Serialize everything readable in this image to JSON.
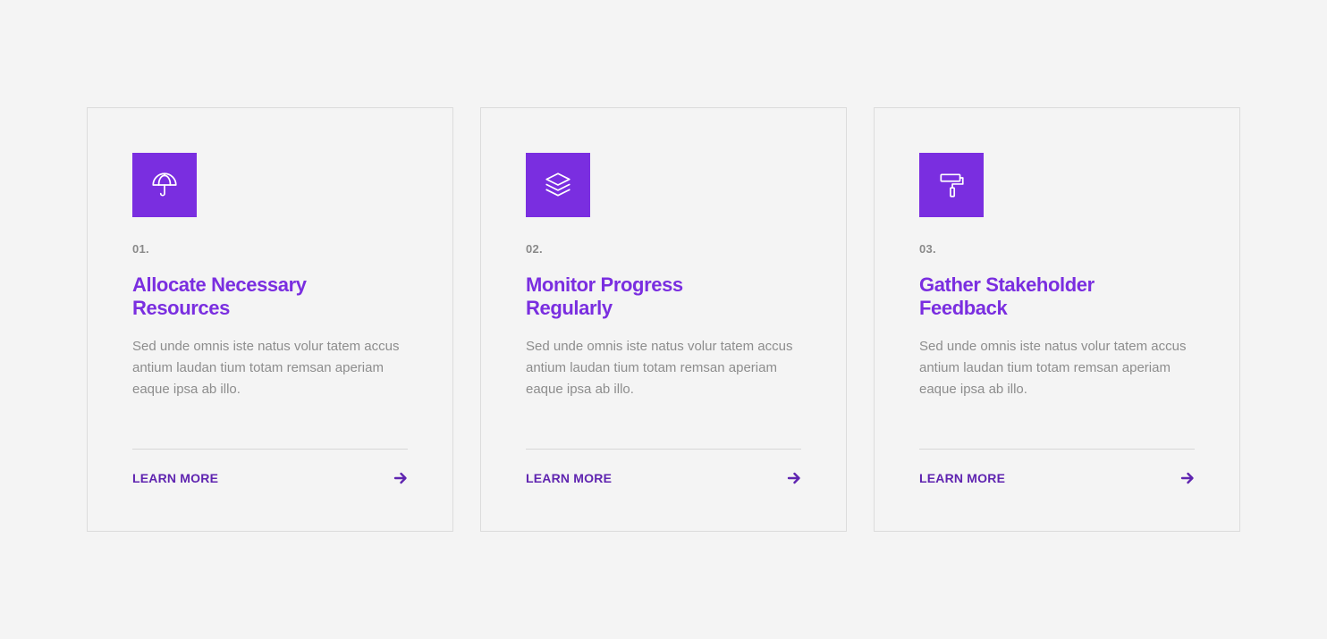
{
  "colors": {
    "accent": "#7a2ee0",
    "link": "#5f24b0",
    "background": "#f4f4f4",
    "muted_text": "#8d8d8d"
  },
  "cards": [
    {
      "icon": "umbrella-icon",
      "number": "01.",
      "title": "Allocate Necessary Resources",
      "description": "Sed unde omnis iste natus volur tatem accus antium laudan tium totam remsan aperiam eaque ipsa ab illo.",
      "link_label": "LEARN MORE",
      "arrow_icon": "arrow-right-icon"
    },
    {
      "icon": "layers-icon",
      "number": "02.",
      "title": "Monitor Progress Regularly",
      "description": "Sed unde omnis iste natus volur tatem accus antium laudan tium totam remsan aperiam eaque ipsa ab illo.",
      "link_label": "LEARN MORE",
      "arrow_icon": "arrow-right-icon"
    },
    {
      "icon": "paint-roller-icon",
      "number": "03.",
      "title": "Gather Stakeholder Feedback",
      "description": "Sed unde omnis iste natus volur tatem accus antium laudan tium totam remsan aperiam eaque ipsa ab illo.",
      "link_label": "LEARN MORE",
      "arrow_icon": "arrow-right-icon"
    }
  ]
}
